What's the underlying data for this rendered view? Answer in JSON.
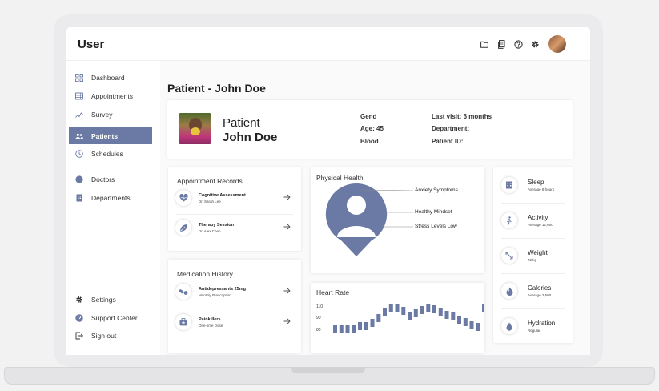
{
  "app": {
    "title": "User"
  },
  "header_icons": [
    "folder-icon",
    "clipboard-icon",
    "help-icon",
    "gear-icon"
  ],
  "sidebar": {
    "items": [
      {
        "label": "Dashboard",
        "icon": "grid-icon"
      },
      {
        "label": "Appointments",
        "icon": "calendar-grid-icon"
      },
      {
        "label": "Survey",
        "icon": "trend-icon"
      },
      {
        "label": "Patients",
        "icon": "people-icon",
        "active": true
      },
      {
        "label": "Schedules",
        "icon": "clock-icon"
      },
      {
        "label": "Doctors",
        "icon": "circle-icon"
      },
      {
        "label": "Departments",
        "icon": "building-icon"
      }
    ],
    "bottom_items": [
      {
        "label": "Settings",
        "icon": "gear-icon"
      },
      {
        "label": "Support Center",
        "icon": "help-icon"
      },
      {
        "label": "Sign out",
        "icon": "logout-icon"
      }
    ]
  },
  "page": {
    "title": "Patient - John Doe"
  },
  "patient": {
    "label": "Patient",
    "name": "John Doe",
    "gender_label": "Gend",
    "age": "Age: 45",
    "blood_label": "Blood",
    "last_visit": "Last visit: 6 months",
    "department_label": "Department:",
    "patient_id_label": "Patient ID:"
  },
  "appointments": {
    "title": "Appointment Records",
    "items": [
      {
        "name": "Cognitive Assessment",
        "doctor": "Dr. Sarah Lee",
        "icon": "heart-pulse-icon"
      },
      {
        "name": "Therapy Session",
        "doctor": "Dr. Alex Chen",
        "icon": "leaf-icon"
      }
    ]
  },
  "medications": {
    "title": "Medication History",
    "items": [
      {
        "name": "Antidepressants 25mg",
        "note": "Monthly Prescription",
        "icon": "pills-icon"
      },
      {
        "name": "Painkillers",
        "note": "One-time Dose",
        "icon": "medkit-icon"
      }
    ]
  },
  "physical_health": {
    "title": "Physical Health",
    "legend": [
      "Anxiety Symptoms",
      "Healthy Mindset",
      "Stress Levels Low"
    ],
    "colors": {
      "accent": "#6a7aa4"
    }
  },
  "stats": [
    {
      "name": "Sleep",
      "sub": "Average 8 hours",
      "icon": "hotel-icon"
    },
    {
      "name": "Activity",
      "sub": "Average 12,000",
      "icon": "walk-icon"
    },
    {
      "name": "Weight",
      "sub": "72 kg",
      "icon": "expand-icon"
    },
    {
      "name": "Calories",
      "sub": "Average 2,500",
      "icon": "flame-icon"
    },
    {
      "name": "Hydration",
      "sub": "Regular",
      "icon": "drop-icon"
    }
  ],
  "chart_data": {
    "type": "bar",
    "title": "Heart Rate",
    "yticks": [
      "110",
      "90",
      "80"
    ],
    "values": [
      80,
      80,
      80,
      83,
      86,
      86,
      90,
      96,
      103,
      108,
      108,
      105,
      99,
      102,
      106,
      108,
      107,
      104,
      100,
      98,
      94,
      91,
      87,
      85,
      108
    ],
    "ylim": [
      72,
      112
    ]
  }
}
